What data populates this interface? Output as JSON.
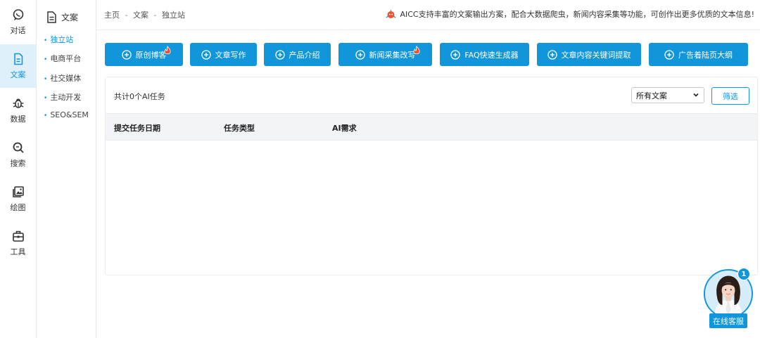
{
  "rail": {
    "items": [
      {
        "label": "对话",
        "icon": "chat-bubble-icon"
      },
      {
        "label": "文案",
        "icon": "document-icon"
      },
      {
        "label": "数据",
        "icon": "bug-icon"
      },
      {
        "label": "搜索",
        "icon": "search-icon"
      },
      {
        "label": "绘图",
        "icon": "image-icon"
      },
      {
        "label": "工具",
        "icon": "toolbox-icon"
      }
    ],
    "active_index": 1
  },
  "subnav": {
    "title": "文案",
    "items": [
      {
        "label": "独立站"
      },
      {
        "label": "电商平台"
      },
      {
        "label": "社交媒体"
      },
      {
        "label": "主动开发"
      },
      {
        "label": "SEO&SEM"
      }
    ],
    "active_index": 0
  },
  "breadcrumb": {
    "items": [
      "主页",
      "文案",
      "独立站"
    ],
    "separator": "-"
  },
  "notice": {
    "text": "AICC支持丰富的文案输出方案，配合大数据爬虫，新闻内容采集等功能，可创作出更多优质的文本信息!",
    "icon": "robot-icon"
  },
  "actions": {
    "buttons": [
      {
        "label": "原创博客",
        "hot": true
      },
      {
        "label": "文章写作",
        "hot": false
      },
      {
        "label": "产品介绍",
        "hot": false
      },
      {
        "label": "新闻采集改写",
        "hot": true
      },
      {
        "label": "FAQ快速生成器",
        "hot": false
      },
      {
        "label": "文章内容关键词提取",
        "hot": false
      },
      {
        "label": "广告着陆页大纲",
        "hot": false
      }
    ]
  },
  "task_panel": {
    "count_text": "共计0个AI任务",
    "filter_select_value": "所有文案",
    "filter_button": "筛选",
    "columns": [
      "提交任务日期",
      "任务类型",
      "AI需求"
    ],
    "rows": []
  },
  "support": {
    "label": "在线客服",
    "badge": "1"
  },
  "colors": {
    "accent": "#1296db",
    "active_bg": "#dff0fb",
    "header_bg": "#f2f4f7",
    "hot": "#f0502f"
  }
}
